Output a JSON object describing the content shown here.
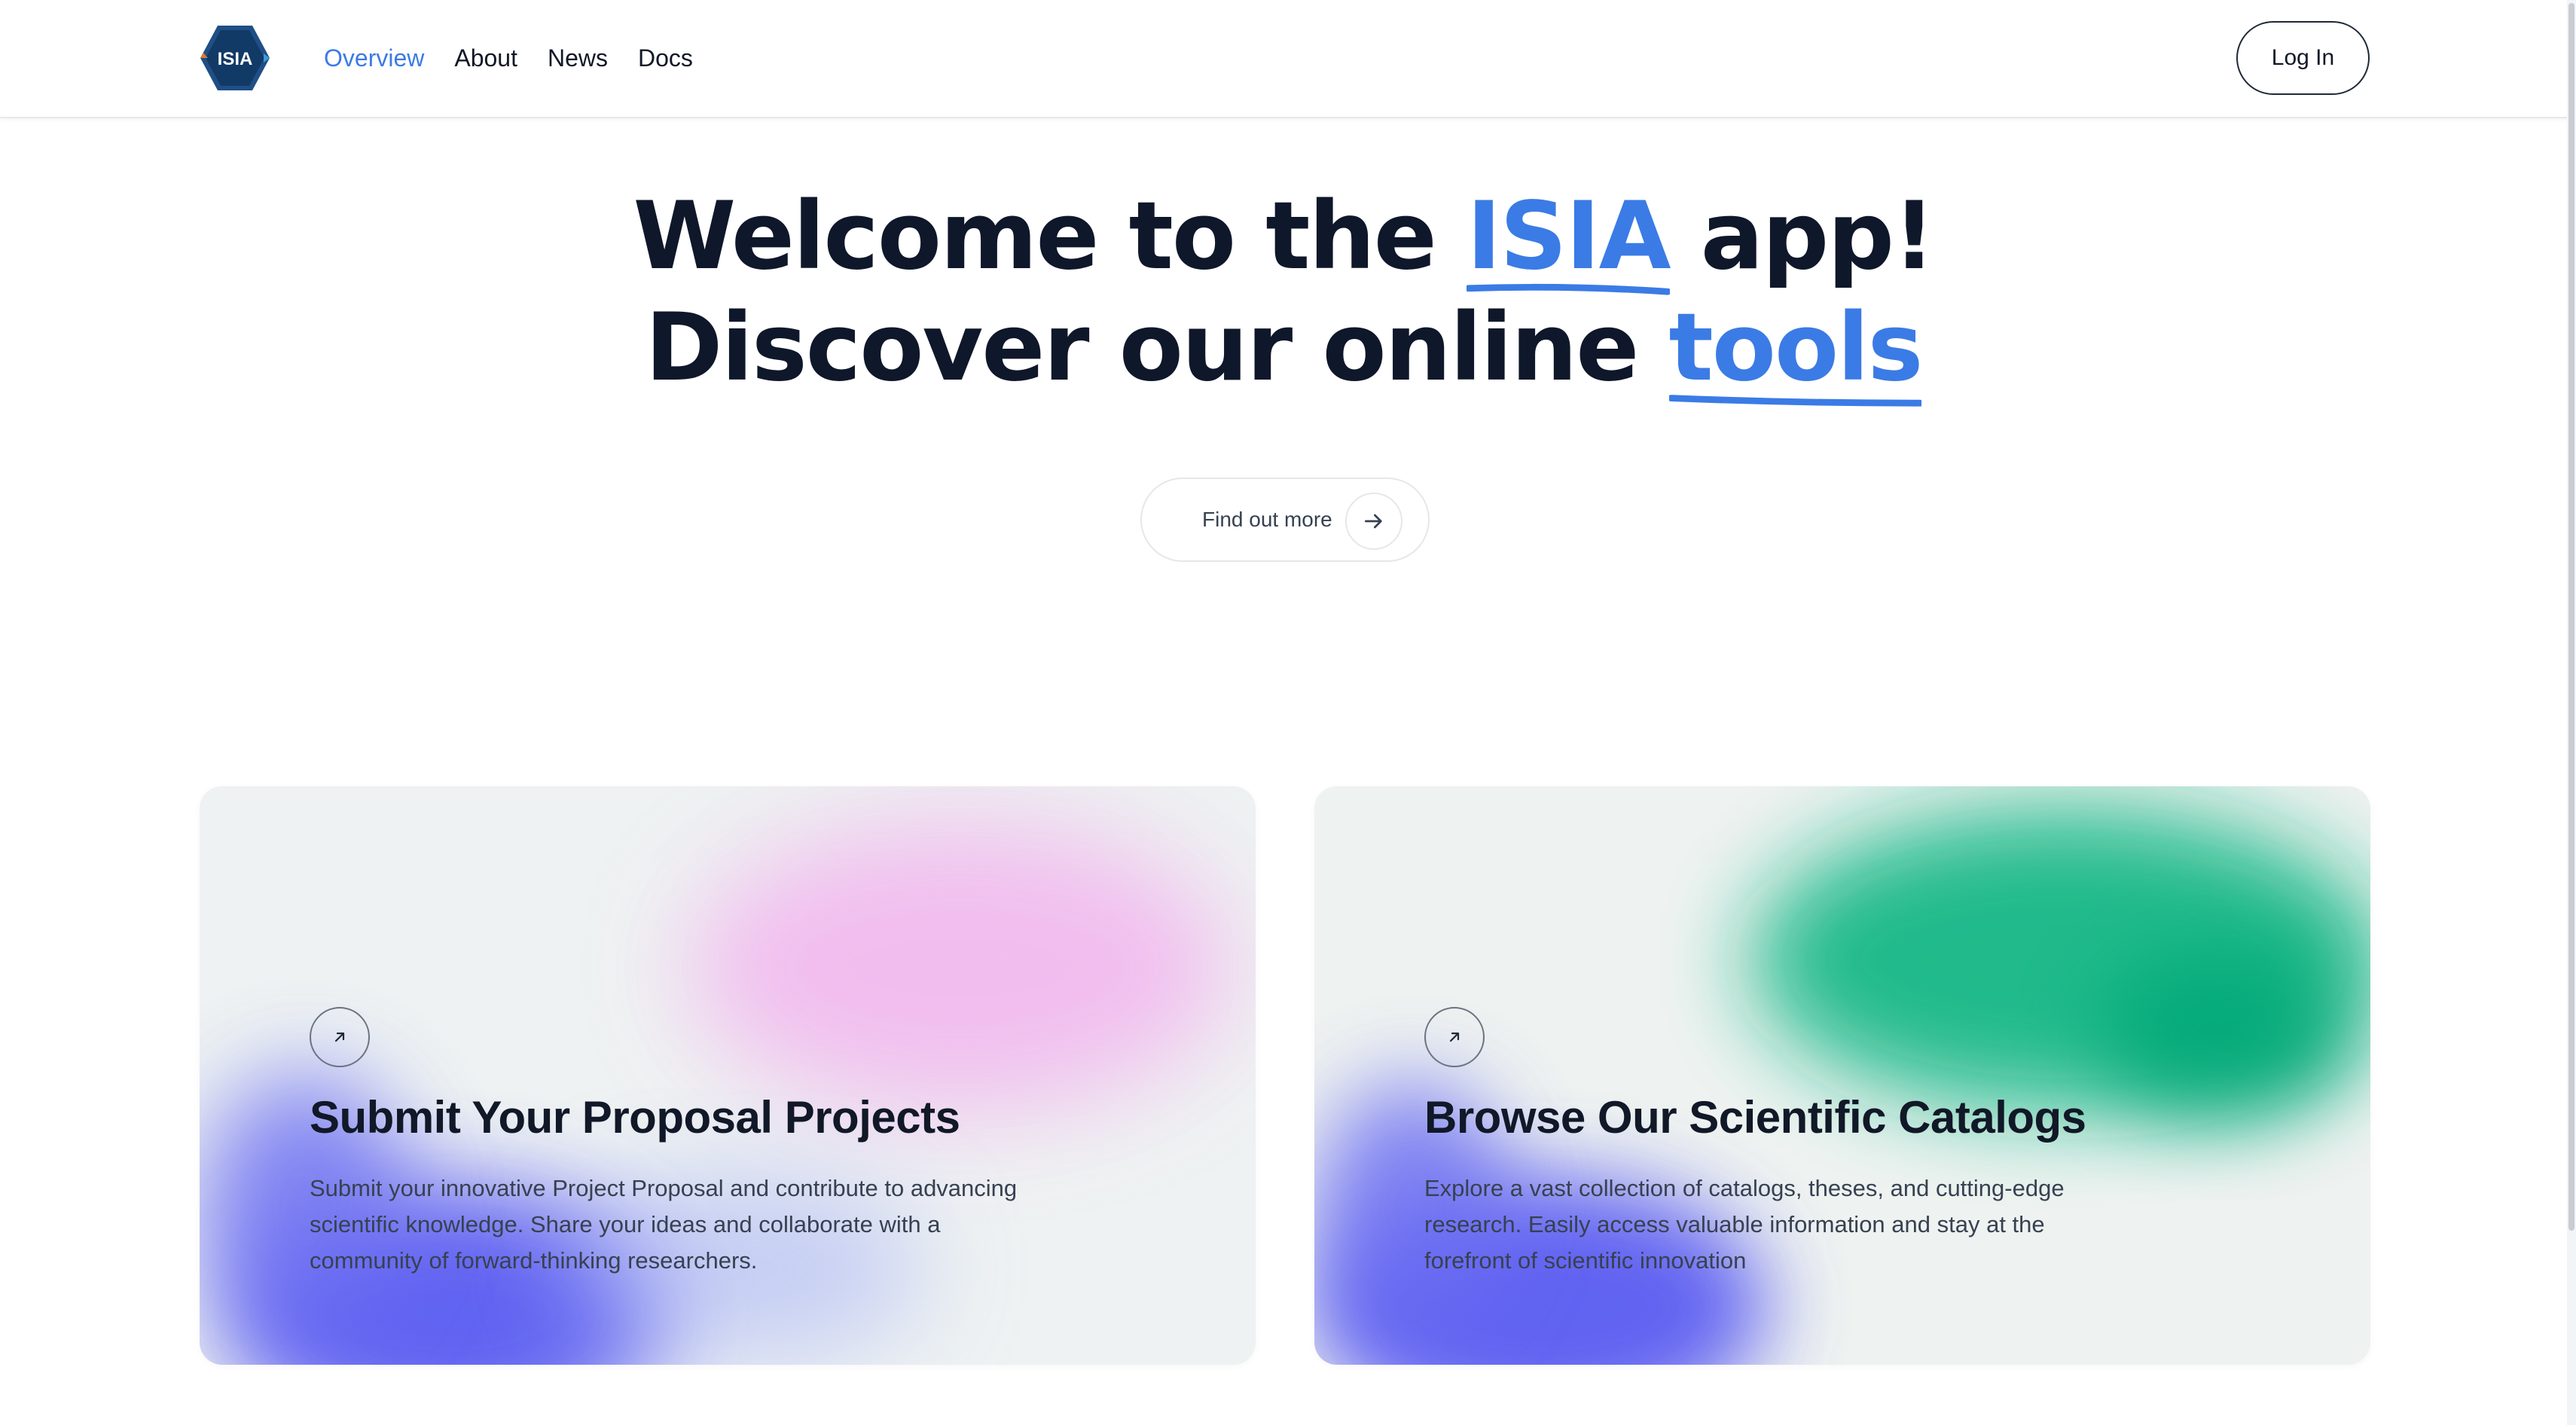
{
  "navbar": {
    "logo_text": "ISIA",
    "links": [
      {
        "label": "Overview",
        "active": true
      },
      {
        "label": "About",
        "active": false
      },
      {
        "label": "News",
        "active": false
      },
      {
        "label": "Docs",
        "active": false
      }
    ],
    "login_label": "Log In"
  },
  "hero": {
    "line1_prefix": "Welcome to the ",
    "line1_highlight": "ISIA",
    "line1_suffix": " app!",
    "line2_prefix": "Discover our online ",
    "line2_highlight": "tools",
    "cta_label": "Find out more",
    "cta_icon": "arrow-right-icon"
  },
  "cards": [
    {
      "icon": "arrow-up-right-icon",
      "title": "Submit Your Proposal Projects",
      "description": "Submit your innovative Project Proposal and contribute to advancing scientific knowledge. Share your ideas and collaborate with a community of forward-thinking researchers."
    },
    {
      "icon": "arrow-up-right-icon",
      "title": "Browse Our Scientific Catalogs",
      "description": "Explore a vast collection of catalogs, theses, and cutting-edge research. Easily access valuable information and stay at the forefront of scientific innovation"
    }
  ],
  "colors": {
    "accent": "#3b7be5",
    "text_dark": "#0f172a",
    "blob_purple": "#5b5cf0",
    "blob_pink": "#f3b7ee",
    "blob_green": "#0fb884"
  }
}
